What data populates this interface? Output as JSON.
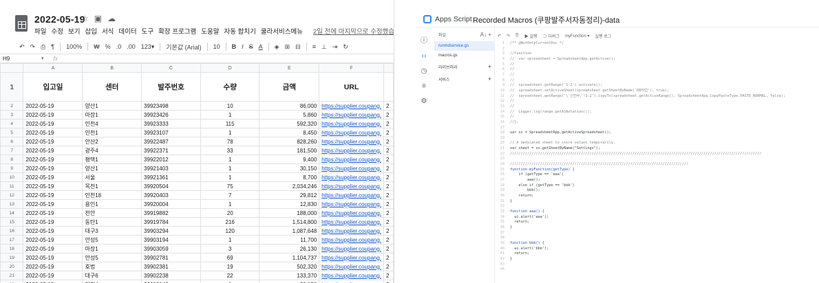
{
  "sheets": {
    "title": "2022-05-19",
    "menu": [
      "파일",
      "수정",
      "보기",
      "삽입",
      "서식",
      "데이터",
      "도구",
      "확장 프로그램",
      "도움말",
      "자동 합치기",
      "쿨라서비스메뉴"
    ],
    "last_edit": "2일 전에 마지막으로 수정했습니다.",
    "toolbar": {
      "zoom": "100%",
      "currency": "₩",
      "percent": "%",
      "dec1": ".0",
      "dec2": ".00",
      "fmt": "123▾",
      "font": "기본값 (Arial)",
      "size": "10"
    },
    "cell_ref": "H9",
    "fx": "fx",
    "col_letters": [
      "A",
      "B",
      "C",
      "D",
      "E",
      "F"
    ],
    "header_row": {
      "rn": "1",
      "cols": [
        "입고일",
        "센터",
        "발주번호",
        "수량",
        "금액",
        "URL"
      ]
    },
    "rows": [
      {
        "rn": "2",
        "date": "2022-05-19",
        "center": "양산1",
        "po": "39923498",
        "qty": "10",
        "amt": "86,000",
        "url": "https://supplier.coupang.",
        "extra": "2"
      },
      {
        "rn": "3",
        "date": "2022-05-19",
        "center": "마장1",
        "po": "39923426",
        "qty": "1",
        "amt": "5,860",
        "url": "https://supplier.coupang.",
        "extra": "2"
      },
      {
        "rn": "4",
        "date": "2022-05-19",
        "center": "인천4",
        "po": "39923333",
        "qty": "115",
        "amt": "592,320",
        "url": "https://supplier.coupang.",
        "extra": "2"
      },
      {
        "rn": "5",
        "date": "2022-05-19",
        "center": "인천1",
        "po": "39923107",
        "qty": "1",
        "amt": "8,450",
        "url": "https://supplier.coupang.",
        "extra": "2"
      },
      {
        "rn": "6",
        "date": "2022-05-19",
        "center": "안산2",
        "po": "39922487",
        "qty": "78",
        "amt": "828,260",
        "url": "https://supplier.coupang.",
        "extra": "2"
      },
      {
        "rn": "7",
        "date": "2022-05-19",
        "center": "광주4",
        "po": "39922371",
        "qty": "33",
        "amt": "181,500",
        "url": "https://supplier.coupang.",
        "extra": "2"
      },
      {
        "rn": "8",
        "date": "2022-05-19",
        "center": "평택1",
        "po": "39922012",
        "qty": "1",
        "amt": "9,400",
        "url": "https://supplier.coupang.",
        "extra": "2"
      },
      {
        "rn": "9",
        "date": "2022-05-19",
        "center": "양산1",
        "po": "39921403",
        "qty": "1",
        "amt": "30,150",
        "url": "https://supplier.coupang.",
        "extra": "2"
      },
      {
        "rn": "10",
        "date": "2022-05-19",
        "center": "서울",
        "po": "39921361",
        "qty": "1",
        "amt": "8,700",
        "url": "https://supplier.coupang.",
        "extra": "2"
      },
      {
        "rn": "11",
        "date": "2022-05-19",
        "center": "목천1",
        "po": "39920504",
        "qty": "75",
        "amt": "2,034,246",
        "url": "https://supplier.coupang.",
        "extra": "2"
      },
      {
        "rn": "12",
        "date": "2022-05-19",
        "center": "인천18",
        "po": "39920403",
        "qty": "7",
        "amt": "29,812",
        "url": "https://supplier.coupang.",
        "extra": "2"
      },
      {
        "rn": "13",
        "date": "2022-05-19",
        "center": "용인1",
        "po": "39920004",
        "qty": "1",
        "amt": "12,830",
        "url": "https://supplier.coupang.",
        "extra": "2"
      },
      {
        "rn": "14",
        "date": "2022-05-19",
        "center": "천안",
        "po": "39919882",
        "qty": "20",
        "amt": "188,000",
        "url": "https://supplier.coupang.",
        "extra": "2"
      },
      {
        "rn": "15",
        "date": "2022-05-19",
        "center": "동탄1",
        "po": "39919784",
        "qty": "216",
        "amt": "1,514,800",
        "url": "https://supplier.coupang.",
        "extra": "2"
      },
      {
        "rn": "16",
        "date": "2022-05-19",
        "center": "대구3",
        "po": "39903294",
        "qty": "120",
        "amt": "1,087,648",
        "url": "https://supplier.coupang.",
        "extra": "2"
      },
      {
        "rn": "17",
        "date": "2022-05-19",
        "center": "안성5",
        "po": "39903194",
        "qty": "1",
        "amt": "11,700",
        "url": "https://supplier.coupang.",
        "extra": "2"
      },
      {
        "rn": "18",
        "date": "2022-05-19",
        "center": "마장1",
        "po": "39903059",
        "qty": "3",
        "amt": "26,130",
        "url": "https://supplier.coupang.",
        "extra": "2"
      },
      {
        "rn": "19",
        "date": "2022-05-19",
        "center": "안성5",
        "po": "39902781",
        "qty": "69",
        "amt": "1,104,737",
        "url": "https://supplier.coupang.",
        "extra": "2"
      },
      {
        "rn": "20",
        "date": "2022-05-19",
        "center": "호법",
        "po": "39902381",
        "qty": "19",
        "amt": "502,320",
        "url": "https://supplier.coupang.",
        "extra": "2"
      },
      {
        "rn": "21",
        "date": "2022-05-19",
        "center": "대구6",
        "po": "39902238",
        "qty": "22",
        "amt": "133,370",
        "url": "https://supplier.coupang.",
        "extra": "2"
      },
      {
        "rn": "22",
        "date": "2022-05-19",
        "center": "인천4",
        "po": "39902149",
        "qty": "1",
        "amt": "30,150",
        "url": "https://supplier.coupang.",
        "extra": "2"
      }
    ]
  },
  "apps_script": {
    "brand": "Apps Script",
    "project": "Recorded Macros (쿠팡발주서자동정리)-data",
    "files_label": "파일",
    "files": [
      "runmdservice.gs",
      "macros.gs"
    ],
    "sections": [
      "라이브러리",
      "서비스"
    ],
    "toolbar": {
      "run": "▶ 실행",
      "debug": "⊃ 디버그",
      "fn": "myFunction ▾",
      "log": "실행 로그"
    },
    "code": [
      {
        "n": "1",
        "t": "/** @NotOnlyCurrentDoc */",
        "c": "cm"
      },
      {
        "n": "2",
        "t": "",
        "c": ""
      },
      {
        "n": "3",
        "t": "//function",
        "c": "cm"
      },
      {
        "n": "4",
        "t": "//  var spreadsheet = SpreadsheetApp.getActive();",
        "c": "cm"
      },
      {
        "n": "5",
        "t": "//",
        "c": "cm"
      },
      {
        "n": "6",
        "t": "//",
        "c": "cm"
      },
      {
        "n": "7",
        "t": "//",
        "c": "cm"
      },
      {
        "n": "8",
        "t": "//",
        "c": "cm"
      },
      {
        "n": "9",
        "t": "//  spreadsheet.getRange('1:2').activate();",
        "c": "cm"
      },
      {
        "n": "10",
        "t": "//  spreadsheet.setActiveSheet(spreadsheet.getSheetByName('DB작업'), true);",
        "c": "cm"
      },
      {
        "n": "11",
        "t": "//  spreadsheet.getRange('\\'인천4\\'!1:2').copyTo(spreadsheet.getActiveRange(), SpreadsheetApp.CopyPasteType.PASTE_NORMAL, false);",
        "c": "cm"
      },
      {
        "n": "12",
        "t": "//",
        "c": "cm"
      },
      {
        "n": "13",
        "t": "//",
        "c": "cm"
      },
      {
        "n": "14",
        "t": "//  Logger.log(range.getA1Notation());",
        "c": "cm"
      },
      {
        "n": "15",
        "t": "//",
        "c": "cm"
      },
      {
        "n": "16",
        "t": "//};",
        "c": "cm"
      },
      {
        "n": "17",
        "t": "",
        "c": ""
      },
      {
        "n": "18",
        "t": "var ss = SpreadsheetApp.getActiveSpreadsheet();",
        "c": ""
      },
      {
        "n": "19",
        "t": "",
        "c": ""
      },
      {
        "n": "20",
        "t": "// A dedicated sheet to store values temporarily.",
        "c": "cm"
      },
      {
        "n": "21",
        "t": "var sheet = ss.getSheetByName(\"Settings\");",
        "c": ""
      },
      {
        "n": "22",
        "t": "/////////////////////////////////////////////////////////////////////////////////////////////////////////////////////",
        "c": "cm"
      },
      {
        "n": "23",
        "t": "",
        "c": ""
      },
      {
        "n": "24",
        "t": "///////////////////////////////////////////////////////////////////////////////////",
        "c": "cm"
      },
      {
        "n": "25",
        "t": "function myFunction(getType) {",
        "c": "kw"
      },
      {
        "n": "26",
        "t": "    if (getType == 'aaa')",
        "c": ""
      },
      {
        "n": "27",
        "t": "        aaa();",
        "c": ""
      },
      {
        "n": "28",
        "t": "    else if (getType == 'bbb')",
        "c": ""
      },
      {
        "n": "29",
        "t": "        bbb();",
        "c": ""
      },
      {
        "n": "30",
        "t": "    return;",
        "c": ""
      },
      {
        "n": "31",
        "t": "}",
        "c": ""
      },
      {
        "n": "32",
        "t": "",
        "c": ""
      },
      {
        "n": "33",
        "t": "function aaa() {",
        "c": "kw"
      },
      {
        "n": "34",
        "t": "  ui.alert('aaa');",
        "c": ""
      },
      {
        "n": "35",
        "t": "  return;",
        "c": ""
      },
      {
        "n": "36",
        "t": "}",
        "c": ""
      },
      {
        "n": "37",
        "t": "",
        "c": ""
      },
      {
        "n": "38",
        "t": "",
        "c": ""
      },
      {
        "n": "39",
        "t": "function bbb() {",
        "c": "kw"
      },
      {
        "n": "40",
        "t": "  ui.alert('bbb');",
        "c": ""
      },
      {
        "n": "41",
        "t": "  return;",
        "c": ""
      },
      {
        "n": "42",
        "t": "}",
        "c": ""
      },
      {
        "n": "43",
        "t": "",
        "c": ""
      },
      {
        "n": "44",
        "t": "",
        "c": ""
      }
    ]
  }
}
